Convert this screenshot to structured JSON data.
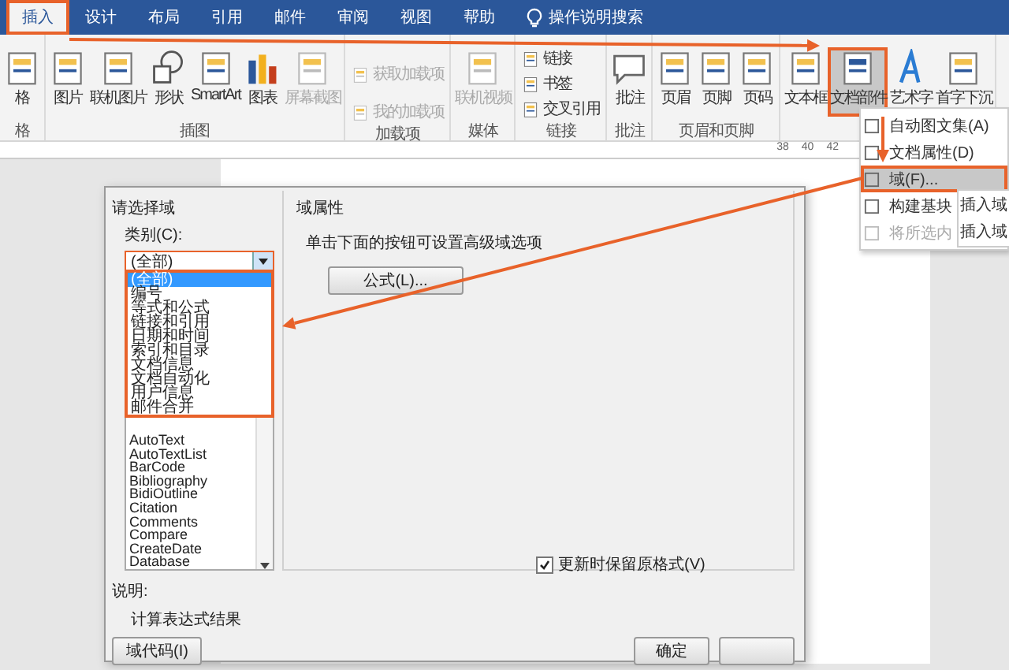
{
  "tabs": [
    {
      "label": "插入",
      "selected": true
    },
    {
      "label": "设计",
      "selected": false
    },
    {
      "label": "布局",
      "selected": false
    },
    {
      "label": "引用",
      "selected": false
    },
    {
      "label": "邮件",
      "selected": false
    },
    {
      "label": "审阅",
      "selected": false
    },
    {
      "label": "视图",
      "selected": false
    },
    {
      "label": "帮助",
      "selected": false
    }
  ],
  "search": {
    "label": "操作说明搜索"
  },
  "ribbon_groups": [
    {
      "label": "格",
      "buttons": [
        {
          "kind": "large",
          "label": "格",
          "disabled": false,
          "highlighted": false
        }
      ]
    },
    {
      "label": "插图",
      "buttons": [
        {
          "kind": "large",
          "label": "图片",
          "disabled": false,
          "highlighted": false
        },
        {
          "kind": "large",
          "label": "联机图片",
          "disabled": false,
          "highlighted": false
        },
        {
          "kind": "large",
          "label": "形状",
          "disabled": false,
          "highlighted": false
        },
        {
          "kind": "large",
          "label": "SmartArt",
          "disabled": false,
          "highlighted": false
        },
        {
          "kind": "large",
          "label": "图表",
          "disabled": false,
          "highlighted": false
        },
        {
          "kind": "large",
          "label": "屏幕截图",
          "disabled": true,
          "highlighted": false
        }
      ]
    },
    {
      "label": "加载项",
      "buttons": [
        {
          "kind": "small",
          "label": "获取加载项",
          "disabled": true
        },
        {
          "kind": "small",
          "label": "我的加载项",
          "disabled": true
        }
      ]
    },
    {
      "label": "媒体",
      "buttons": [
        {
          "kind": "large",
          "label": "联机视频",
          "disabled": true,
          "highlighted": false
        }
      ]
    },
    {
      "label": "链接",
      "buttons": [
        {
          "kind": "small",
          "label": "链接",
          "disabled": false
        },
        {
          "kind": "small",
          "label": "书签",
          "disabled": false
        },
        {
          "kind": "small",
          "label": "交叉引用",
          "disabled": false
        }
      ]
    },
    {
      "label": "批注",
      "buttons": [
        {
          "kind": "large",
          "label": "批注",
          "disabled": false,
          "highlighted": false
        }
      ]
    },
    {
      "label": "页眉和页脚",
      "buttons": [
        {
          "kind": "large",
          "label": "页眉",
          "disabled": false,
          "highlighted": false
        },
        {
          "kind": "large",
          "label": "页脚",
          "disabled": false,
          "highlighted": false
        },
        {
          "kind": "large",
          "label": "页码",
          "disabled": false,
          "highlighted": false
        }
      ]
    },
    {
      "buttons": [
        {
          "kind": "large",
          "label": "文本框",
          "disabled": false,
          "highlighted": false
        },
        {
          "kind": "large",
          "label": "文档部件",
          "disabled": false,
          "highlighted": true
        },
        {
          "kind": "large",
          "label": "艺术字",
          "disabled": false,
          "highlighted": false
        },
        {
          "kind": "large",
          "label": "首字下沉",
          "disabled": false,
          "highlighted": false
        }
      ]
    }
  ],
  "ruler": [
    "38",
    "40",
    "42"
  ],
  "menu": {
    "items": [
      {
        "label": "自动图文集(A)",
        "disabled": false,
        "selected": false
      },
      {
        "label": "文档属性(D)",
        "disabled": false,
        "selected": false
      },
      {
        "label": "域(F)...",
        "disabled": false,
        "selected": true
      },
      {
        "label": "构建基块",
        "disabled": false,
        "selected": false
      },
      {
        "label": "将所选内",
        "disabled": true,
        "selected": false
      }
    ],
    "submenu": [
      "插入域",
      "插入域"
    ]
  },
  "dialog": {
    "left_title": "请选择域",
    "category_label": "类别(C):",
    "category_value": "(全部)",
    "categories": [
      {
        "label": "(全部)",
        "selected": true
      },
      {
        "label": "编号",
        "selected": false
      },
      {
        "label": "等式和公式",
        "selected": false
      },
      {
        "label": "链接和引用",
        "selected": false
      },
      {
        "label": "日期和时间",
        "selected": false
      },
      {
        "label": "索引和目录",
        "selected": false
      },
      {
        "label": "文档信息",
        "selected": false
      },
      {
        "label": "文档自动化",
        "selected": false
      },
      {
        "label": "用户信息",
        "selected": false
      },
      {
        "label": "邮件合并",
        "selected": false
      }
    ],
    "field_names": [
      "AutoText",
      "AutoTextList",
      "BarCode",
      "Bibliography",
      "BidiOutline",
      "Citation",
      "Comments",
      "Compare",
      "CreateDate",
      "Database"
    ],
    "right_title": "域属性",
    "hint": "单击下面的按钮可设置高级域选项",
    "formula_button": "公式(L)...",
    "keep_format": {
      "label": "更新时保留原格式(V)",
      "checked": true
    },
    "description_label": "说明:",
    "description": "计算表达式结果",
    "buttons": [
      "域代码(I)",
      "确定"
    ]
  }
}
